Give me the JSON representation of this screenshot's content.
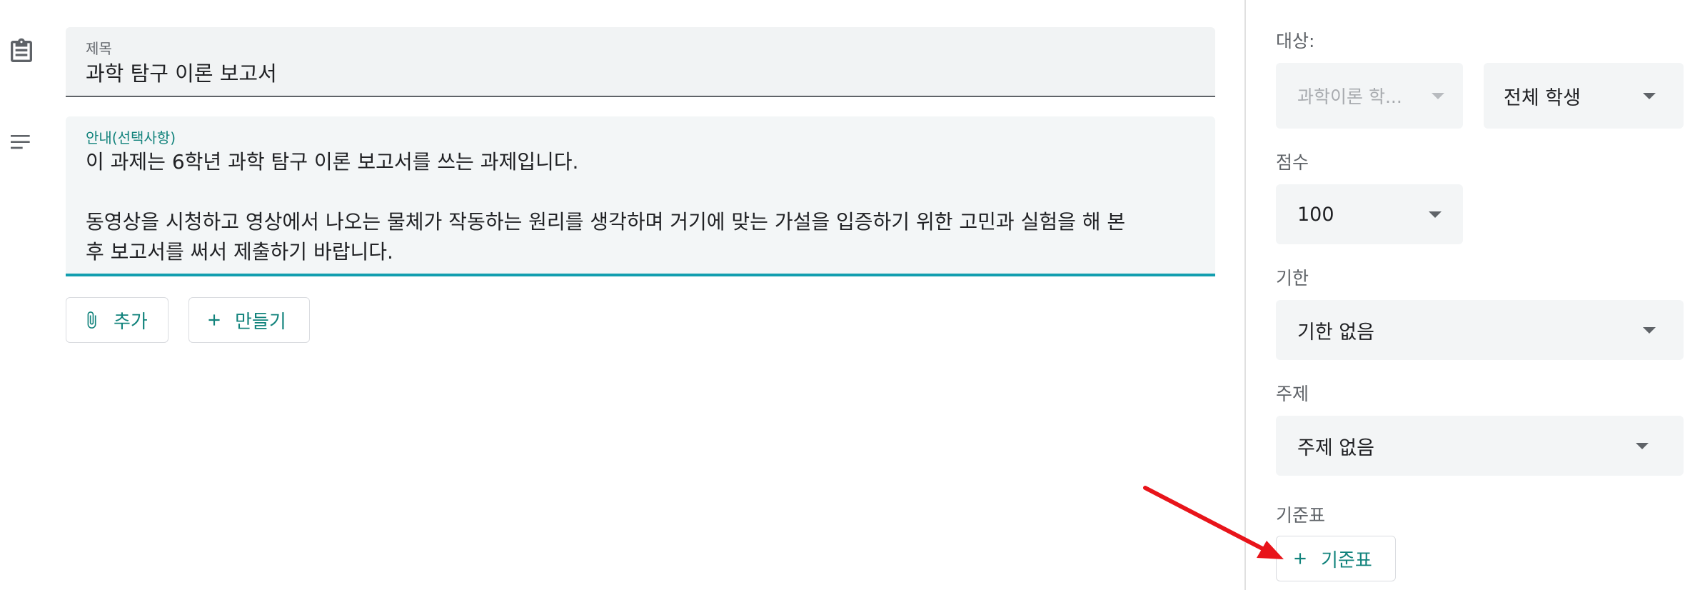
{
  "form": {
    "title_label": "제목",
    "title_value": "과학 탐구 이론 보고서",
    "description_label": "안내(선택사항)",
    "description_lines": [
      "이 과제는 6학년 과학 탐구 이론 보고서를 쓰는 과제입니다.",
      "",
      "동영상을 시청하고 영상에서 나오는 물체가 작동하는 원리를 생각하며 거기에 맞는 가설을 입증하기 위한 고민과 실험을 해 본",
      "후 보고서를 써서 제출하기 바랍니다."
    ],
    "add_label": "추가",
    "create_label": "만들기"
  },
  "sidebar": {
    "for_label": "대상:",
    "class_select": "과학이론 학...",
    "students_select": "전체 학생",
    "points_label": "점수",
    "points_select": "100",
    "due_label": "기한",
    "due_select": "기한 없음",
    "topic_label": "주제",
    "topic_select": "주제 없음",
    "rubric_label": "기준표",
    "rubric_button": "기준표"
  },
  "colors": {
    "accent": "#129eaf",
    "accent_text": "#12837c",
    "annotation_arrow": "#e8141a"
  },
  "icons": {
    "title": "clipboard-icon",
    "description": "subject-lines-icon",
    "add": "paperclip-icon",
    "create": "plus-icon",
    "rubric": "plus-icon"
  }
}
